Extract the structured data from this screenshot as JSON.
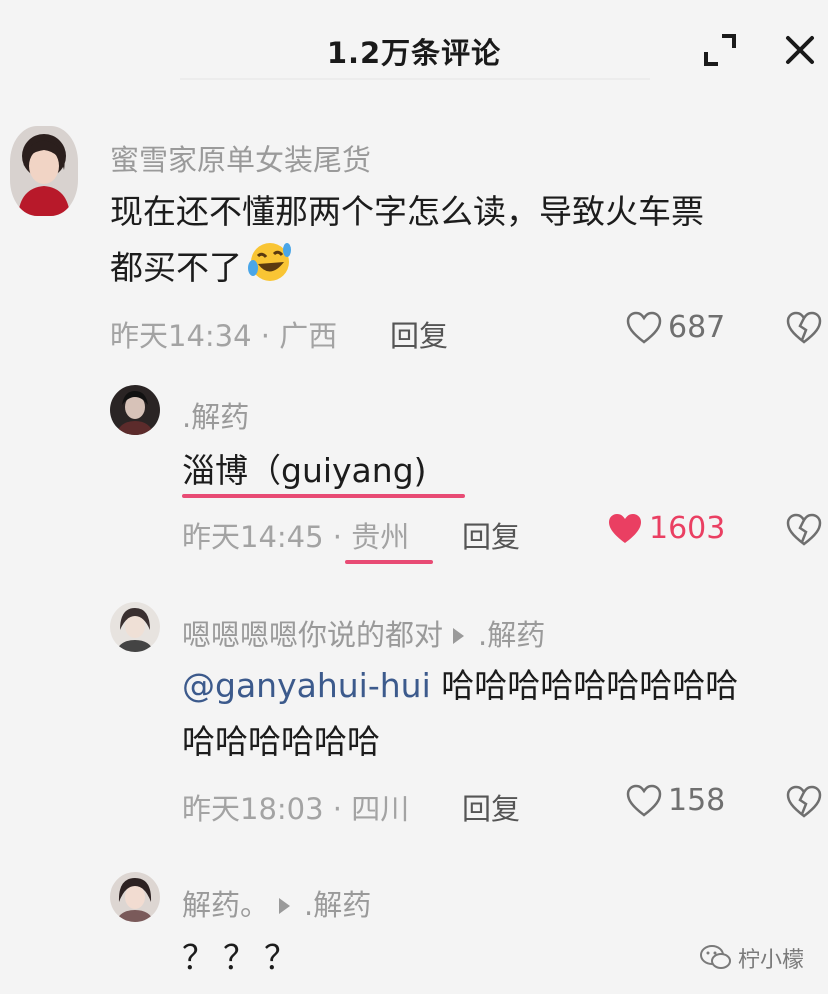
{
  "header": {
    "title": "1.2万条评论",
    "expand_icon": "expand-icon",
    "close_icon": "close-icon"
  },
  "comments": [
    {
      "username": "蜜雪家原单女装尾货",
      "line1": "现在还不懂那两个字怎么读，导致火车票",
      "line2": "都买不了",
      "emoji": "laughing-crying-emoji",
      "time": "昨天14:34 · 广西",
      "reply_label": "回复",
      "likes": "687",
      "liked": false
    },
    {
      "username": ".解药",
      "line1": "淄博（guiyang)",
      "time_prefix": "昨天14:45 · ",
      "location": "贵州",
      "reply_label": "回复",
      "likes": "1603",
      "liked": true,
      "highlight_color": "#e84b74"
    },
    {
      "username": "嗯嗯嗯嗯你说的都对",
      "reply_to": ".解药",
      "mention": "@ganyahui-hui",
      "line1_rest": " 哈哈哈哈哈哈哈哈哈",
      "line2": "哈哈哈哈哈哈",
      "time": "昨天18:03 · 四川",
      "reply_label": "回复",
      "likes": "158",
      "liked": false
    },
    {
      "username": "解药。",
      "reply_to": ".解药",
      "line1": "？？？"
    }
  ],
  "watermark": {
    "text": "柠小檬"
  },
  "colors": {
    "liked": "#ea3f62",
    "mention": "#3c5a8c",
    "meta": "#a3a3a3"
  }
}
